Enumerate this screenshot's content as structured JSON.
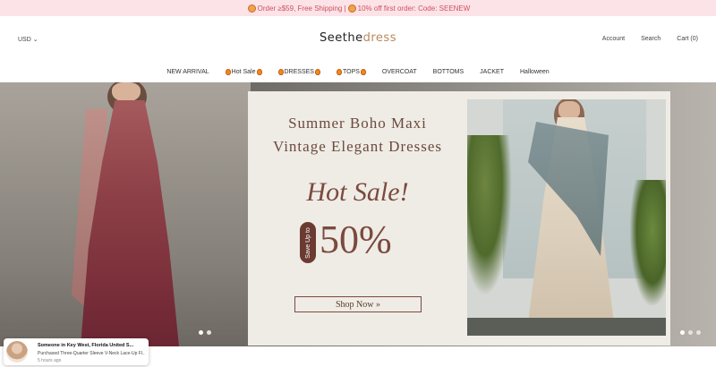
{
  "announcement": {
    "text_1": "Order ≥$59, Free Shipping | ",
    "text_2": "10% off first order: Code: SEENEW"
  },
  "header": {
    "currency": "USD ⌄",
    "logo_part1": "Seethe",
    "logo_part2": "dress",
    "account": "Account",
    "search": "Search",
    "cart": "Cart (0)"
  },
  "nav": {
    "items": [
      {
        "label": "NEW ARRIVAL",
        "fire": false
      },
      {
        "label": "Hot Sale",
        "fire": true
      },
      {
        "label": "DRESSES",
        "fire": true
      },
      {
        "label": "TOPS",
        "fire": true
      },
      {
        "label": "OVERCOAT",
        "fire": false
      },
      {
        "label": "BOTTOMS",
        "fire": false
      },
      {
        "label": "JACKET",
        "fire": false
      },
      {
        "label": "Halloween",
        "fire": false
      }
    ]
  },
  "hero": {
    "title_line1": "Summer Boho Maxi",
    "title_line2": "Vintage Elegant Dresses",
    "hot_sale": "Hot Sale!",
    "save_up": "Save Up to",
    "percent": "50%",
    "shop_now": "Shop Now »"
  },
  "toast": {
    "title": "Someone in Key West, Florida United S...",
    "subtitle": "Purchased Three-Quarter Sleeve V-Neck Lace-Up Fl...",
    "time": "5 hours ago"
  },
  "colors": {
    "announce_bg": "#fbe3e7",
    "announce_text": "#d0505f",
    "accent_brown": "#7b4a3e"
  }
}
